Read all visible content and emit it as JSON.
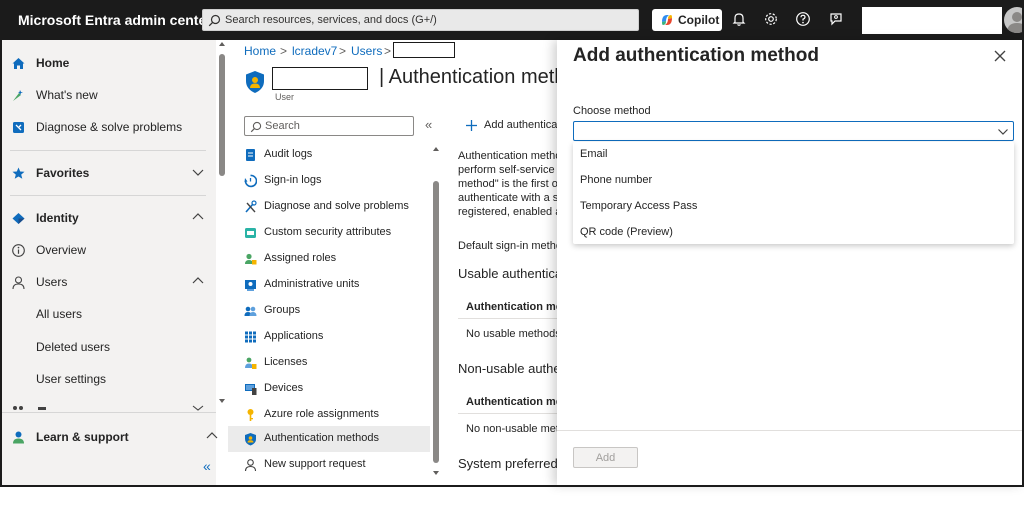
{
  "app": {
    "title": "Microsoft Entra admin center"
  },
  "topbar": {
    "search_placeholder": "Search resources, services, and docs (G+/)",
    "copilot_label": "Copilot",
    "icons": [
      "bell-icon",
      "gear-icon",
      "help-icon",
      "feedback-icon"
    ]
  },
  "leftnav": {
    "home": "Home",
    "whats_new": "What's new",
    "diagnose": "Diagnose & solve problems",
    "favorites": "Favorites",
    "identity": "Identity",
    "overview": "Overview",
    "users": "Users",
    "all_users": "All users",
    "deleted_users": "Deleted users",
    "user_settings": "User settings",
    "learn_support": "Learn & support",
    "collapse": "«"
  },
  "breadcrumb": {
    "home": "Home",
    "tenant": "lcradev7",
    "users": "Users",
    "sep": ">"
  },
  "page": {
    "title": "| Authentication methods",
    "subtitle": "User"
  },
  "resource_menu": {
    "search_placeholder": "Search",
    "collapse": "«",
    "items": [
      {
        "label": "Audit logs",
        "icon": "audit-logs-icon"
      },
      {
        "label": "Sign-in logs",
        "icon": "sign-in-logs-icon"
      },
      {
        "label": "Diagnose and solve problems",
        "icon": "wrench-icon"
      },
      {
        "label": "Custom security attributes",
        "icon": "security-attributes-icon"
      },
      {
        "label": "Assigned roles",
        "icon": "roles-icon"
      },
      {
        "label": "Administrative units",
        "icon": "admin-units-icon"
      },
      {
        "label": "Groups",
        "icon": "groups-icon"
      },
      {
        "label": "Applications",
        "icon": "applications-icon"
      },
      {
        "label": "Licenses",
        "icon": "licenses-icon"
      },
      {
        "label": "Devices",
        "icon": "devices-icon"
      },
      {
        "label": "Azure role assignments",
        "icon": "key-icon"
      },
      {
        "label": "Authentication methods",
        "icon": "shield-icon",
        "selected": true
      },
      {
        "label": "New support request",
        "icon": "support-icon"
      }
    ]
  },
  "main": {
    "add_button": "Add authenticat",
    "desc_lines": [
      "Authentication metho",
      "perform self-service p",
      "method\" is the first or",
      "authenticate with a se",
      "registered, enabled ac"
    ],
    "default_signin": "Default sign-in metho",
    "usable_heading": "Usable authenticat",
    "usable_col": "Authentication met",
    "usable_empty": "No usable methods",
    "nonusable_heading": "Non-usable authen",
    "nonusable_col": "Authentication met",
    "nonusable_empty": "No non-usable met",
    "system_preferred": "System preferred n"
  },
  "panel": {
    "title": "Add authentication method",
    "field_label": "Choose method",
    "selected_value": "",
    "options": [
      "Email",
      "Phone number",
      "Temporary Access Pass",
      "QR code (Preview)"
    ],
    "add_button": "Add"
  },
  "colors": {
    "topbar": "#1b1b1b",
    "link": "#0f6cbd",
    "nav_bg": "#f3f2f1",
    "accent_blue": "#0f6cbd"
  }
}
